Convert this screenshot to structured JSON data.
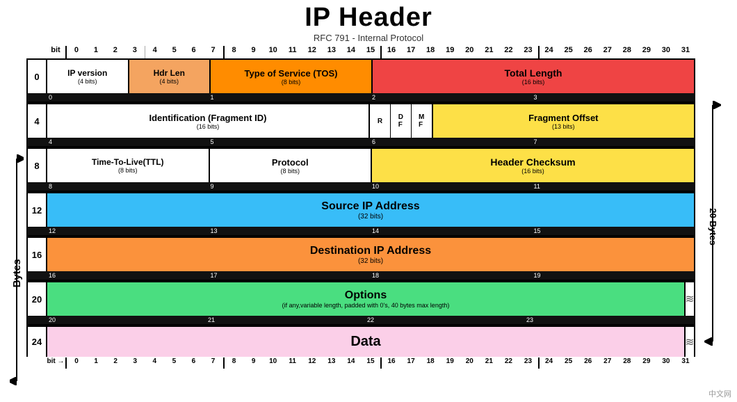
{
  "title": "IP Header",
  "subtitle": "RFC 791 - Internal Protocol",
  "bits": [
    0,
    1,
    2,
    3,
    4,
    5,
    6,
    7,
    8,
    9,
    10,
    11,
    12,
    13,
    14,
    15,
    16,
    17,
    18,
    19,
    20,
    21,
    22,
    23,
    24,
    25,
    26,
    27,
    28,
    29,
    30,
    31
  ],
  "left_label": "Bytes",
  "right_label": "20 Bytes",
  "rows": [
    {
      "byte": "0",
      "cells": [
        {
          "label": "IP version",
          "sub": "(4 bits)",
          "bits": 4,
          "color": "white",
          "border": true
        },
        {
          "label": "Hdr Len",
          "sub": "(4 bits)",
          "bits": 4,
          "color": "orange_light",
          "border": true
        },
        {
          "label": "Type of Service (TOS)",
          "sub": "(8 bits)",
          "bits": 8,
          "color": "orange",
          "border": true
        },
        {
          "label": "Total Length",
          "sub": "(16 bits)",
          "bits": 16,
          "color": "red",
          "border": false
        }
      ],
      "numbers": [
        {
          "val": "0",
          "at": 0
        },
        {
          "val": "1",
          "at": 8
        },
        {
          "val": "2",
          "at": 16
        },
        {
          "val": "3",
          "at": 24
        }
      ]
    },
    {
      "byte": "4",
      "cells": [
        {
          "label": "Identification (Fragment ID)",
          "sub": "(16 bits)",
          "bits": 16,
          "color": "white",
          "border": true
        },
        {
          "label": "R",
          "sub": "",
          "bits": 1,
          "color": "white",
          "border": true
        },
        {
          "label": "D\nF",
          "sub": "",
          "bits": 1,
          "color": "white",
          "border": true
        },
        {
          "label": "M\nF",
          "sub": "",
          "bits": 1,
          "color": "white",
          "border": true
        },
        {
          "label": "Fragment Offset",
          "sub": "(13 bits)",
          "bits": 13,
          "color": "yellow",
          "border": false
        }
      ],
      "numbers": [
        {
          "val": "4",
          "at": 0
        },
        {
          "val": "5",
          "at": 8
        },
        {
          "val": "6",
          "at": 16
        },
        {
          "val": "7",
          "at": 24
        }
      ]
    },
    {
      "byte": "8",
      "cells": [
        {
          "label": "Time-To-Live(TTL)",
          "sub": "(8 bits)",
          "bits": 8,
          "color": "white",
          "border": true
        },
        {
          "label": "Protocol",
          "sub": "(8 bits)",
          "bits": 8,
          "color": "white",
          "border": true
        },
        {
          "label": "Header Checksum",
          "sub": "(16 bits)",
          "bits": 16,
          "color": "yellow",
          "border": false
        }
      ],
      "numbers": [
        {
          "val": "8",
          "at": 0
        },
        {
          "val": "9",
          "at": 8
        },
        {
          "val": "10",
          "at": 16
        },
        {
          "val": "11",
          "at": 24
        }
      ]
    },
    {
      "byte": "12",
      "cells": [
        {
          "label": "Source IP Address",
          "sub": "(32 bits)",
          "bits": 32,
          "color": "blue",
          "border": false
        }
      ],
      "numbers": [
        {
          "val": "12",
          "at": 0
        },
        {
          "val": "13",
          "at": 8
        },
        {
          "val": "14",
          "at": 16
        },
        {
          "val": "15",
          "at": 24
        }
      ]
    },
    {
      "byte": "16",
      "cells": [
        {
          "label": "Destination IP Address",
          "sub": "(32 bits)",
          "bits": 32,
          "color": "orange2",
          "border": false
        }
      ],
      "numbers": [
        {
          "val": "16",
          "at": 0
        },
        {
          "val": "17",
          "at": 8
        },
        {
          "val": "18",
          "at": 16
        },
        {
          "val": "19",
          "at": 24
        }
      ]
    },
    {
      "byte": "20",
      "cells": [
        {
          "label": "Options",
          "sub": "(if any,variable length, padded with 0's, 40 bytes max length)",
          "bits": 32,
          "color": "green",
          "border": false
        }
      ],
      "numbers": [
        {
          "val": "20",
          "at": 0
        },
        {
          "val": "21",
          "at": 8
        },
        {
          "val": "22",
          "at": 16
        },
        {
          "val": "23",
          "at": 24
        }
      ],
      "zigzag": true
    },
    {
      "byte": "24",
      "cells": [
        {
          "label": "Data",
          "sub": "",
          "bits": 32,
          "color": "pink",
          "border": false
        }
      ],
      "zigzag": true
    }
  ],
  "bottom_bits_label": "bit →",
  "watermark": "中文网"
}
